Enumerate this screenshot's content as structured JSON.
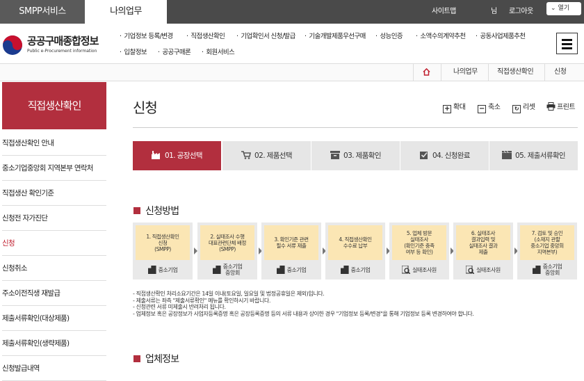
{
  "topbar": {
    "tabs": [
      "SMPP서비스",
      "나의업무"
    ],
    "links": {
      "sitemap": "사이트맵",
      "user": "님",
      "logout": "로그아웃"
    },
    "open_label": "열기"
  },
  "logo": {
    "title": "공공구매종합정보",
    "subtitle": "Public e-Procurement information"
  },
  "gnb": {
    "items": [
      "기업정보 등록/변경",
      "직접생산확인",
      "기업확인서 신청/발급",
      "기술개발제품우선구매",
      "성능인증",
      "소액수의계약추천",
      "공동사업제품추천",
      "입찰정보",
      "공공구매론",
      "회원서비스"
    ]
  },
  "breadcrumb": {
    "items": [
      "나의업무",
      "직접생산확인",
      "신청"
    ]
  },
  "sidebar": {
    "title": "직접생산확인",
    "items": [
      "직접생산확인 안내",
      "중소기업중앙회 지역본부 연락처",
      "직접생산 확인기준",
      "신청전 자가진단",
      "신청",
      "신청취소",
      "주소이전직생 재발급",
      "제출서류확인(대상제품)",
      "제출서류확인(생략제품)",
      "신청발급내역"
    ],
    "active_index": 4
  },
  "page": {
    "title": "신청",
    "tools": [
      "확대",
      "축소",
      "리셋",
      "프린트"
    ]
  },
  "steps": [
    "01. 공장선택",
    "02. 제품선택",
    "03. 제품확인",
    "04. 신청완료",
    "05. 제출서류확인"
  ],
  "section1": {
    "title": "신청방법"
  },
  "process": [
    {
      "text": "1. 직접생산확인\n신청\n(SMPP)",
      "who": "중소기업"
    },
    {
      "text": "2. 실태조사 수행\n대표관련단체 배정\n(SMPP)",
      "who": "중소기업\n중앙회"
    },
    {
      "text": "3. 확인기준 관련\n필수 서류 제출",
      "who": "중소기업"
    },
    {
      "text": "4. 직접생산확인\n수수료 납부",
      "who": "중소기업"
    },
    {
      "text": "5. 업체 방문\n실태조사\n(확인기준 충족\n여부 등 확인)",
      "who": "실태조사원"
    },
    {
      "text": "6. 실태조사\n결과입력 및\n실태조사 결과\n제출",
      "who": "실태조사원"
    },
    {
      "text": "7. 검토 및 승인\n(소재지 관할\n중소기업 중앙회\n지역본부)",
      "who": "중소기업\n중앙회"
    }
  ],
  "notes": [
    "- 직접생산확인 처리소요기간은 14일 이내(토요일, 일요일 및 법정공휴일은 제외)입니다.",
    "- 제출서류는 좌측 \"제출서류확인\" 메뉴를 확인하시기 바랍니다.",
    "- 신청관련 서류 미제출시 반려처리 됩니다.",
    "- 업체정보 혹은 공장정보가 사업자등록증명 혹은 공장등록증명 등의 서류 내용과 상이한 경우 \"기업정보 등록/변경\"을 통해 기업정보 등록 변경하여야 합니다."
  ],
  "section2": {
    "title": "업체정보"
  },
  "colors": {
    "accent": "#b22f3e",
    "topbar": "#4a4a4a",
    "process_box": "#fbe6b4"
  }
}
